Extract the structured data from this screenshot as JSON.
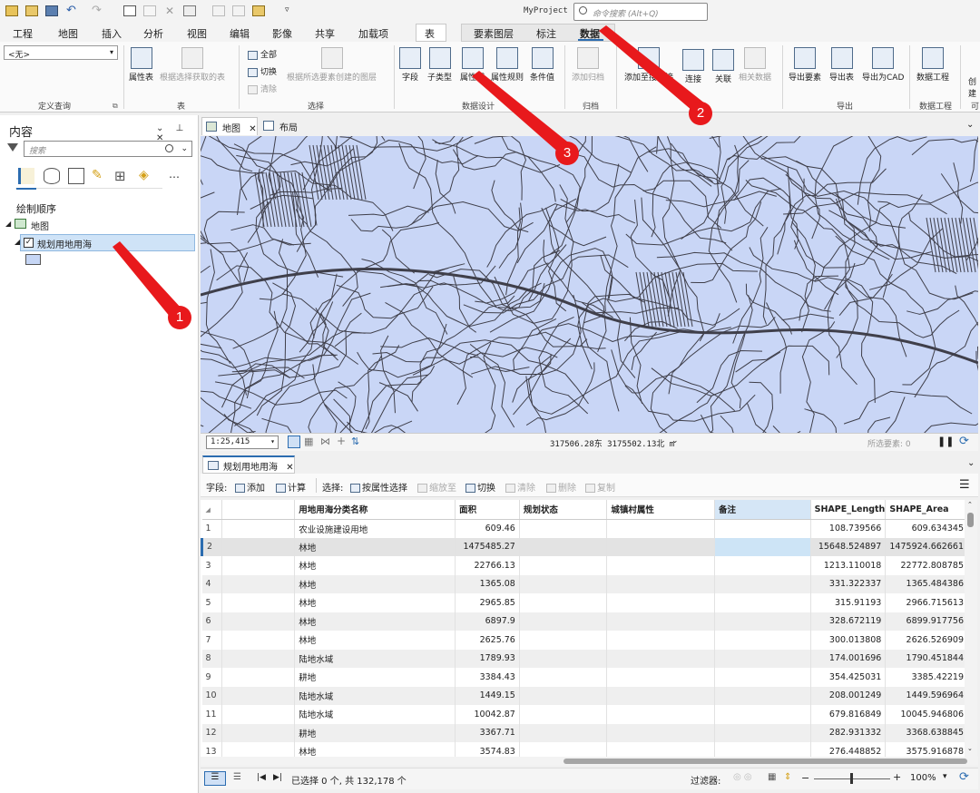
{
  "window": {
    "title": "MyProject",
    "command_search_placeholder": "命令搜索 (Alt+Q)"
  },
  "ribbon_tabs": [
    "工程",
    "地图",
    "插入",
    "分析",
    "视图",
    "编辑",
    "影像",
    "共享",
    "加载项",
    "表",
    "要素图层",
    "标注",
    "数据"
  ],
  "active_tab": "数据",
  "ribbon": {
    "definition_query": {
      "value": "<无>",
      "group_label": "定义查询"
    },
    "table_group": {
      "label": "表",
      "attribute_table": "属性表",
      "table_from_selection": "根据选择获取的表"
    },
    "selection_group": {
      "label": "选择",
      "all": "全部",
      "switch": "切换",
      "clear": "清除",
      "layer_from_selection": "根据所选要素创建的图层"
    },
    "data_design_group": {
      "label": "数据设计",
      "fields": "字段",
      "subtypes": "子类型",
      "domains": "属性域",
      "attribute_rules": "属性规则",
      "contingent_values": "条件值"
    },
    "archive_group": {
      "label": "归档",
      "add_archiving": "添加归档"
    },
    "relate_group": {
      "add_join": "添加至接",
      "join_suffix": "连接",
      "join": "连接",
      "relate": "关联",
      "related_data": "相关数据"
    },
    "export_group": {
      "label": "导出",
      "export_features": "导出要素",
      "export_table": "导出表",
      "export_cad": "导出为CAD"
    },
    "data_eng_group": {
      "label": "数据工程",
      "data_engineering": "数据工程"
    },
    "cut_create": "创建",
    "cut_can": "可"
  },
  "contents": {
    "title": "内容",
    "search_placeholder": "搜索",
    "drawing_order": "绘制顺序",
    "map_node": "地图",
    "layer_name": "规划用地用海",
    "layer_checked": "✓"
  },
  "view_tabs": {
    "map": "地图",
    "layout": "布局"
  },
  "map_status": {
    "scale": "1:25,415",
    "coordinates": "317506.28东 3175502.13北 m",
    "selected_features": "所选要素: 0"
  },
  "map_colors": {
    "background": "#c9d6f6",
    "lines": "#3f3f4a"
  },
  "table": {
    "tab_name": "规划用地用海",
    "toolbar": {
      "field_label": "字段:",
      "add": "添加",
      "calculate": "计算",
      "select_label": "选择:",
      "select_by_attr": "按属性选择",
      "zoom_to": "缩放至",
      "switch": "切换",
      "clear": "清除",
      "delete": "删除",
      "copy": "复制"
    },
    "columns": [
      "",
      "",
      "用地用海分类名称",
      "面积",
      "规划状态",
      "城镇村属性",
      "备注",
      "SHAPE_Length",
      "SHAPE_Area"
    ],
    "rows": [
      {
        "n": "1",
        "name": "农业设施建设用地",
        "area": "609.46",
        "len": "108.739566",
        "sarea": "609.634345"
      },
      {
        "n": "2",
        "name": "林地",
        "area": "1475485.27",
        "len": "15648.524897",
        "sarea": "1475924.662661"
      },
      {
        "n": "3",
        "name": "林地",
        "area": "22766.13",
        "len": "1213.110018",
        "sarea": "22772.808785"
      },
      {
        "n": "4",
        "name": "林地",
        "area": "1365.08",
        "len": "331.322337",
        "sarea": "1365.484386"
      },
      {
        "n": "5",
        "name": "林地",
        "area": "2965.85",
        "len": "315.91193",
        "sarea": "2966.715613"
      },
      {
        "n": "6",
        "name": "林地",
        "area": "6897.9",
        "len": "328.672119",
        "sarea": "6899.917756"
      },
      {
        "n": "7",
        "name": "林地",
        "area": "2625.76",
        "len": "300.013808",
        "sarea": "2626.526909"
      },
      {
        "n": "8",
        "name": "陆地水域",
        "area": "1789.93",
        "len": "174.001696",
        "sarea": "1790.451844"
      },
      {
        "n": "9",
        "name": "耕地",
        "area": "3384.43",
        "len": "354.425031",
        "sarea": "3385.42219"
      },
      {
        "n": "10",
        "name": "陆地水域",
        "area": "1449.15",
        "len": "208.001249",
        "sarea": "1449.596964"
      },
      {
        "n": "11",
        "name": "陆地水域",
        "area": "10042.87",
        "len": "679.816849",
        "sarea": "10045.946806"
      },
      {
        "n": "12",
        "name": "耕地",
        "area": "3367.71",
        "len": "282.931332",
        "sarea": "3368.638845"
      },
      {
        "n": "13",
        "name": "林地",
        "area": "3574.83",
        "len": "276.448852",
        "sarea": "3575.916878"
      }
    ],
    "status": {
      "selection": "已选择 0 个, 共 132,178 个",
      "filter_label": "过滤器:",
      "zoom": "100%"
    }
  },
  "annotations": [
    "1",
    "2",
    "3"
  ]
}
